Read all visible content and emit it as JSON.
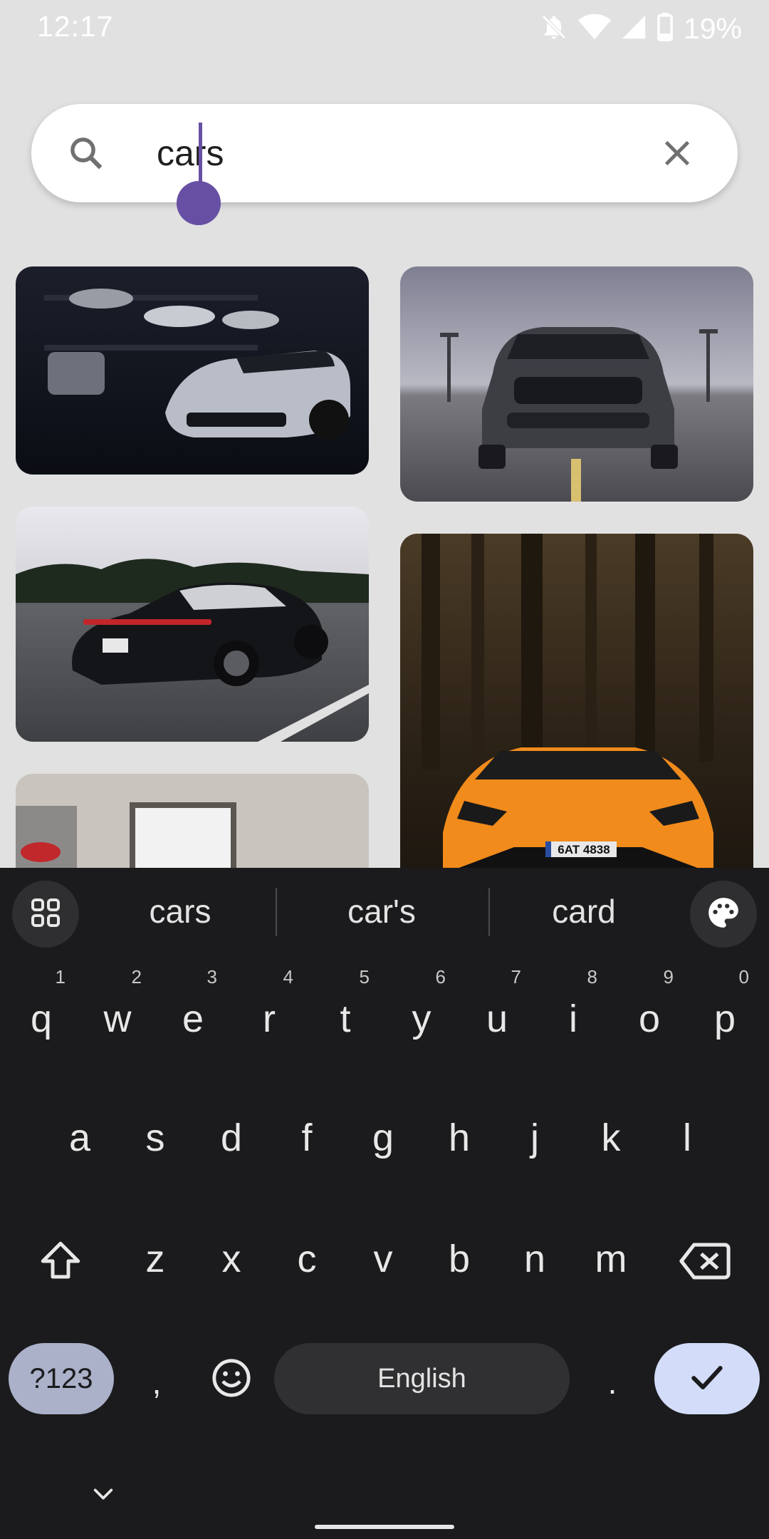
{
  "status_bar": {
    "time": "12:17",
    "battery": "19%",
    "icons": [
      "notifications-off-icon",
      "wifi-icon",
      "cell-signal-icon",
      "battery-icon"
    ]
  },
  "search": {
    "value": "cars",
    "icons": [
      "search-icon",
      "clear-icon"
    ]
  },
  "results": {
    "tiles": [
      {
        "description_icon": "image"
      },
      {
        "description_icon": "image"
      },
      {
        "description_icon": "image"
      },
      {
        "description_icon": "image"
      },
      {
        "description_icon": "image"
      }
    ],
    "plate_text": "6AT 4838"
  },
  "keyboard": {
    "suggestions": [
      "cars",
      "car's",
      "card"
    ],
    "row1": [
      {
        "key": "q",
        "hint": "1"
      },
      {
        "key": "w",
        "hint": "2"
      },
      {
        "key": "e",
        "hint": "3"
      },
      {
        "key": "r",
        "hint": "4"
      },
      {
        "key": "t",
        "hint": "5"
      },
      {
        "key": "y",
        "hint": "6"
      },
      {
        "key": "u",
        "hint": "7"
      },
      {
        "key": "i",
        "hint": "8"
      },
      {
        "key": "o",
        "hint": "9"
      },
      {
        "key": "p",
        "hint": "0"
      }
    ],
    "row2": [
      "a",
      "s",
      "d",
      "f",
      "g",
      "h",
      "j",
      "k",
      "l"
    ],
    "row3": [
      "z",
      "x",
      "c",
      "v",
      "b",
      "n",
      "m"
    ],
    "symbols_label": "?123",
    "comma": ",",
    "space_label": "English",
    "period": ".",
    "accent_color": "#d3ddfa",
    "cursor_color": "#6750a4"
  }
}
